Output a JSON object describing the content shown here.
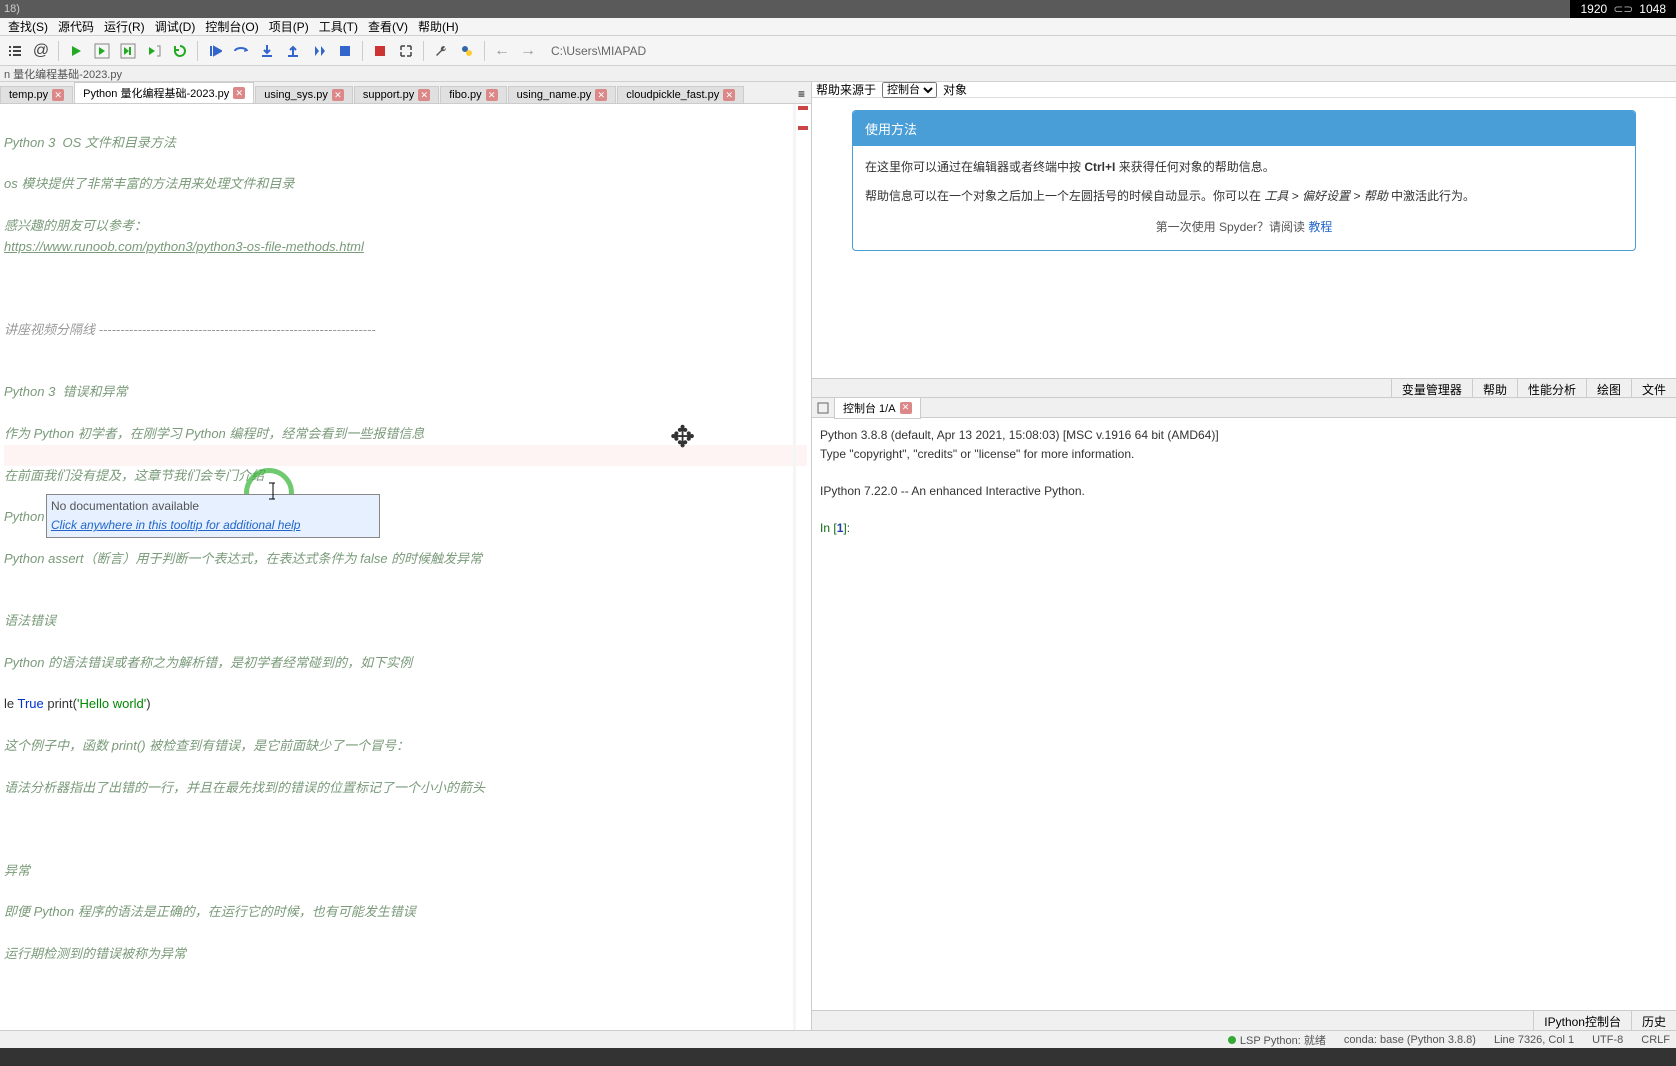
{
  "titlebar": {
    "left": "18)"
  },
  "resolution": {
    "w": "1920",
    "h": "1048"
  },
  "menubar": [
    "查找(S)",
    "源代码",
    "运行(R)",
    "调试(D)",
    "控制台(O)",
    "项目(P)",
    "工具(T)",
    "查看(V)",
    "帮助(H)"
  ],
  "path": "C:\\Users\\MIAPAD",
  "breadcrumb": "n 量化编程基础-2023.py",
  "editor_tabs": [
    {
      "label": "temp.py",
      "active": false
    },
    {
      "label": "Python 量化编程基础-2023.py",
      "active": true
    },
    {
      "label": "using_sys.py",
      "active": false
    },
    {
      "label": "support.py",
      "active": false
    },
    {
      "label": "fibo.py",
      "active": false
    },
    {
      "label": "using_name.py",
      "active": false
    },
    {
      "label": "cloudpickle_fast.py",
      "active": false
    }
  ],
  "tooltip": {
    "line1": "No documentation available",
    "line2": "Click anywhere in this tooltip for additional help"
  },
  "code": {
    "l1": "Python 3  OS 文件和目录方法",
    "l2": "os 模块提供了非常丰富的方法用来处理文件和目录",
    "l3": "感兴趣的朋友可以参考：",
    "l4": "https://www.runoob.com/python3/python3-os-file-methods.html",
    "l5": "讲座视频分隔线 ----------------------------------------------------------------",
    "l6": "Python 3  错误和异常",
    "l7": "作为 Python 初学者，在刚学习 Python 编程时，经常会看到一些报错信息",
    "l8": "在前面我们没有提及，这章节我们会专门介绍",
    "l9": "Python 有两种错误很容易辨认：语法错误 和 异常",
    "l10": "Python assert（断言）用于判断一个表达式，在表达式条件为 false 的时候触发异常",
    "l11": "语法错误",
    "l12": "Python 的语法错误或者称之为解析错，是初学者经常碰到的，如下实例",
    "l13a": "le ",
    "l13b": "True ",
    "l13c": "print",
    "l13d": "(",
    "l13e": "'Hello world'",
    "l13f": ")",
    "l14": "这个例子中，函数 print() 被检查到有错误，是它前面缺少了一个冒号：",
    "l15": "语法分析器指出了出错的一行，并且在最先找到的错误的位置标记了一个小小的箭头",
    "l16": "异常",
    "l17": "即便 Python 程序的语法是正确的，在运行它的时候，也有可能发生错误",
    "l18": "运行期检测到的错误被称为异常"
  },
  "help": {
    "source_label": "帮助来源于",
    "source_selected": "控制台",
    "object_label": "对象",
    "card_title": "使用方法",
    "body1a": "在这里你可以通过在编辑器或者终端中按 ",
    "body1b": "Ctrl+I",
    "body1c": " 来获得任何对象的帮助信息。",
    "body2a": "帮助信息可以在一个对象之后加上一个左圆括号的时候自动显示。你可以在 ",
    "body2b": "工具 > 偏好设置 > 帮助",
    "body2c": " 中激活此行为。",
    "footer_text": "第一次使用 Spyder？请阅读 ",
    "footer_link": "教程"
  },
  "right_tabs": [
    "变量管理器",
    "帮助",
    "性能分析",
    "绘图",
    "文件"
  ],
  "console": {
    "tab_label": "控制台 1/A",
    "line1": "Python 3.8.8 (default, Apr 13 2021, 15:08:03) [MSC v.1916 64 bit (AMD64)]",
    "line2": "Type \"copyright\", \"credits\" or \"license\" for more information.",
    "line3": "IPython 7.22.0 -- An enhanced Interactive Python.",
    "prompt_in": "In [",
    "prompt_num": "1",
    "prompt_end": "]:"
  },
  "console_bottom_tabs": [
    "IPython控制台",
    "历史"
  ],
  "status": {
    "lsp": "LSP Python: 就绪",
    "conda": "conda: base (Python 3.8.8)",
    "line": "Line 7326, Col 1",
    "encoding": "UTF-8",
    "eol": "CRLF"
  }
}
